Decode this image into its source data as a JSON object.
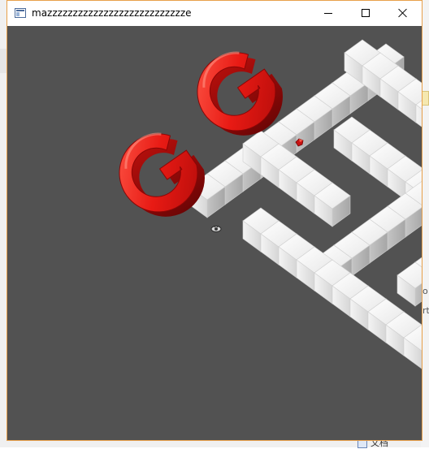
{
  "window": {
    "title": "mazzzzzzzzzzzzzzzzzzzzzzzzzzze",
    "minimize_label": "Minimize",
    "maximize_label": "Maximize",
    "close_label": "Close"
  },
  "scene": {
    "background_color": "#525252",
    "wall_color": "#f2f2f2",
    "logo_color": "#e01818",
    "logo_letters": [
      "G",
      "G"
    ],
    "player_icon": "player-eye-icon",
    "pickup_icon": "red-gem-icon"
  },
  "background": {
    "bottom_text": "文档",
    "right_text_1": "o",
    "right_text_2": "rt"
  }
}
